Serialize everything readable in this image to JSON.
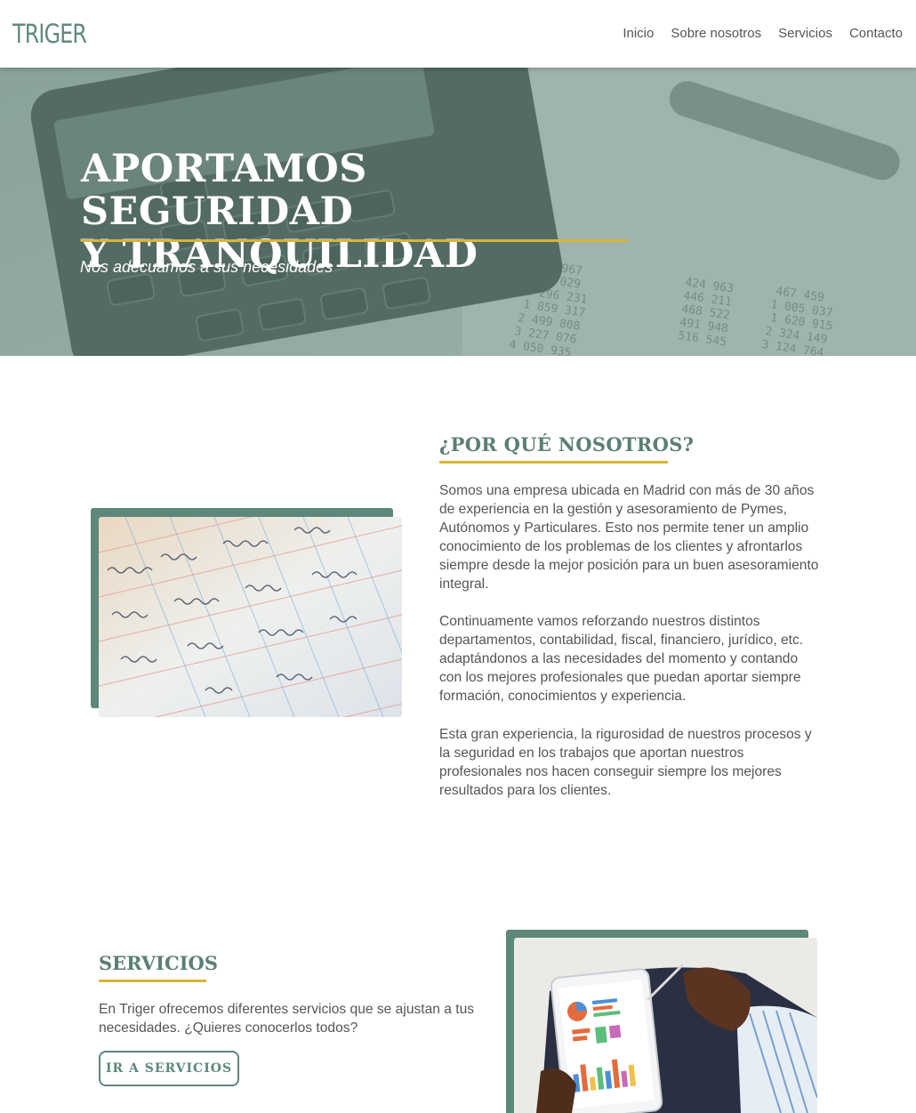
{
  "header": {
    "logo_text": "TRIGER",
    "nav": [
      {
        "label": "Inicio"
      },
      {
        "label": "Sobre nosotros"
      },
      {
        "label": "Servicios"
      },
      {
        "label": "Contacto"
      }
    ]
  },
  "hero": {
    "title_line1": "APORTAMOS SEGURIDAD",
    "title_line2": "Y TRANQUILIDAD",
    "subtitle": "Nos adecuamos a sus necesidades"
  },
  "why": {
    "title": "¿POR QUÉ NOSOTROS?",
    "paragraphs": [
      "Somos una empresa ubicada en Madrid con más de 30 años de experiencia en la gestión y asesoramiento de Pymes, Autónomos y Particulares. Esto nos permite tener un amplio conocimiento de los problemas de los clientes y afrontarlos siempre desde la mejor posición para un buen asesoramiento integral.",
      "Continuamente vamos reforzando nuestros distintos departamentos, contabilidad, fiscal, financiero, jurídico, etc. adaptándonos a las necesidades del momento y contando con los mejores profesionales que puedan aportar siempre formación, conocimientos y experiencia.",
      "Esta gran experiencia, la rigurosidad de nuestros procesos y la seguridad en los trabajos que aportan nuestros profesionales nos hacen conseguir siempre los mejores resultados para los clientes."
    ]
  },
  "services": {
    "title": "SERVICIOS",
    "text": "En Triger ofrecemos diferentes servicios que se ajustan a tus necesidades. ¿Quieres conocerlos todos?",
    "button_label": "IR A SERVICIOS"
  },
  "colors": {
    "brand_green": "#5d877b",
    "accent_gold": "#d8b53a",
    "body_text": "#555555"
  }
}
